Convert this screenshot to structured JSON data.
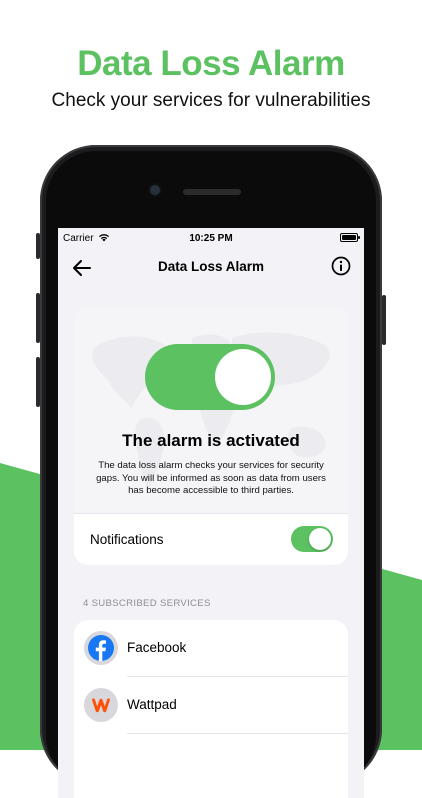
{
  "promo": {
    "headline": "Data Loss Alarm",
    "subline": "Check your services for vulnerabilities"
  },
  "status_bar": {
    "carrier": "Carrier",
    "time": "10:25 PM"
  },
  "nav": {
    "title": "Data Loss Alarm",
    "back_icon": "arrow-left-icon",
    "info_icon": "info-icon"
  },
  "alarm_card": {
    "toggle_on": true,
    "title": "The alarm is activated",
    "description": "The data loss alarm checks your services for security gaps. You will be informed as soon as data from users has become accessible to third parties.",
    "notifications_label": "Notifications",
    "notifications_on": true
  },
  "services_section": {
    "header": "4 SUBSCRIBED SERVICES",
    "items": [
      {
        "name": "Facebook",
        "icon": "facebook-logo"
      },
      {
        "name": "Wattpad",
        "icon": "wattpad-logo"
      }
    ]
  },
  "colors": {
    "accent_green": "#5cc160",
    "screen_bg": "#f2f2f7",
    "facebook_blue": "#1877f2",
    "wattpad_orange": "#ff500a"
  }
}
